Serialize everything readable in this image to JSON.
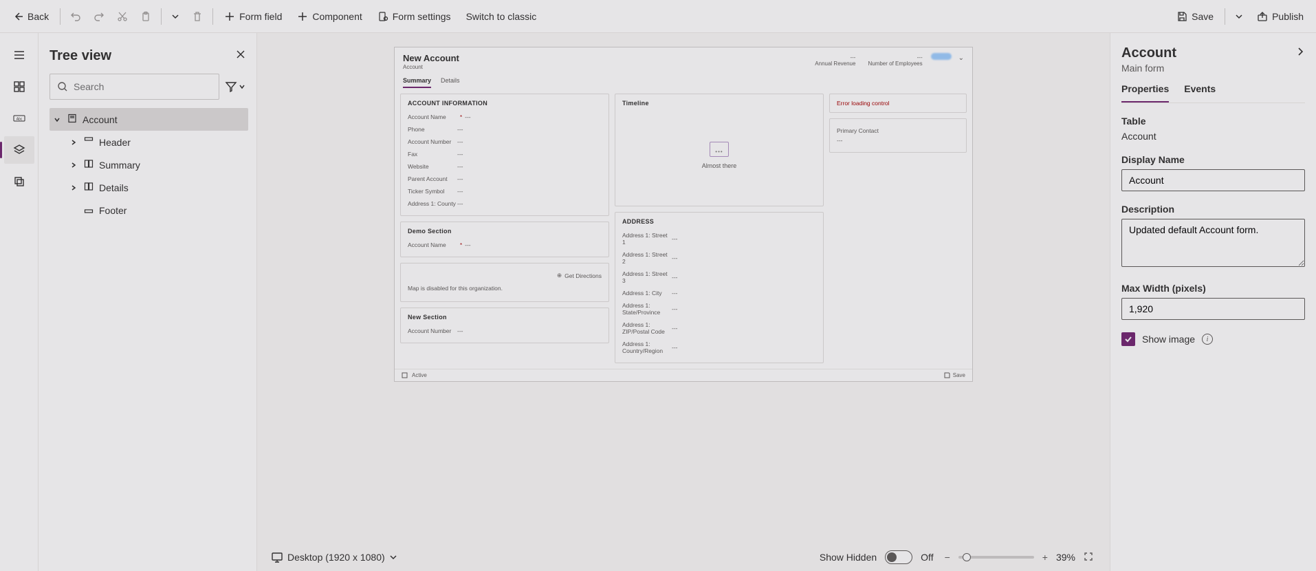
{
  "cmdbar": {
    "back": "Back",
    "form_field": "Form field",
    "component": "Component",
    "form_settings": "Form settings",
    "switch_classic": "Switch to classic",
    "save": "Save",
    "publish": "Publish"
  },
  "tree": {
    "title": "Tree view",
    "search_placeholder": "Search",
    "nodes": {
      "root": "Account",
      "header": "Header",
      "summary": "Summary",
      "details": "Details",
      "footer": "Footer"
    }
  },
  "preview": {
    "title": "New Account",
    "subtitle": "Account",
    "header_fields": {
      "rev": "Annual Revenue",
      "emp": "Number of Employees"
    },
    "tabs": {
      "summary": "Summary",
      "details": "Details"
    },
    "sections": {
      "account_info": "ACCOUNT INFORMATION",
      "timeline": "Timeline",
      "address": "ADDRESS",
      "demo": "Demo Section",
      "new_section": "New Section"
    },
    "fields": {
      "account_name": "Account Name",
      "phone": "Phone",
      "account_number": "Account Number",
      "fax": "Fax",
      "website": "Website",
      "parent_account": "Parent Account",
      "ticker": "Ticker Symbol",
      "county": "Address 1: County",
      "street1": "Address 1: Street 1",
      "street2": "Address 1: Street 2",
      "street3": "Address 1: Street 3",
      "city": "Address 1: City",
      "state": "Address 1: State/Province",
      "zip": "Address 1: ZIP/Postal Code",
      "country": "Address 1: Country/Region",
      "primary_contact": "Primary Contact",
      "account_number2": "Account Number"
    },
    "timeline_msg": "Almost there",
    "error_msg": "Error loading control",
    "get_directions": "Get Directions",
    "map_msg": "Map is disabled for this organization.",
    "footer_active": "Active",
    "footer_save": "Save",
    "dash": "---"
  },
  "status": {
    "viewport": "Desktop (1920 x 1080)",
    "show_hidden": "Show Hidden",
    "toggle_state": "Off",
    "zoom": "39%"
  },
  "props": {
    "title": "Account",
    "subtitle": "Main form",
    "tabs": {
      "properties": "Properties",
      "events": "Events"
    },
    "table_label": "Table",
    "table_value": "Account",
    "display_name_label": "Display Name",
    "display_name_value": "Account",
    "description_label": "Description",
    "description_value": "Updated default Account form.",
    "max_width_label": "Max Width (pixels)",
    "max_width_value": "1,920",
    "show_image_label": "Show image"
  }
}
